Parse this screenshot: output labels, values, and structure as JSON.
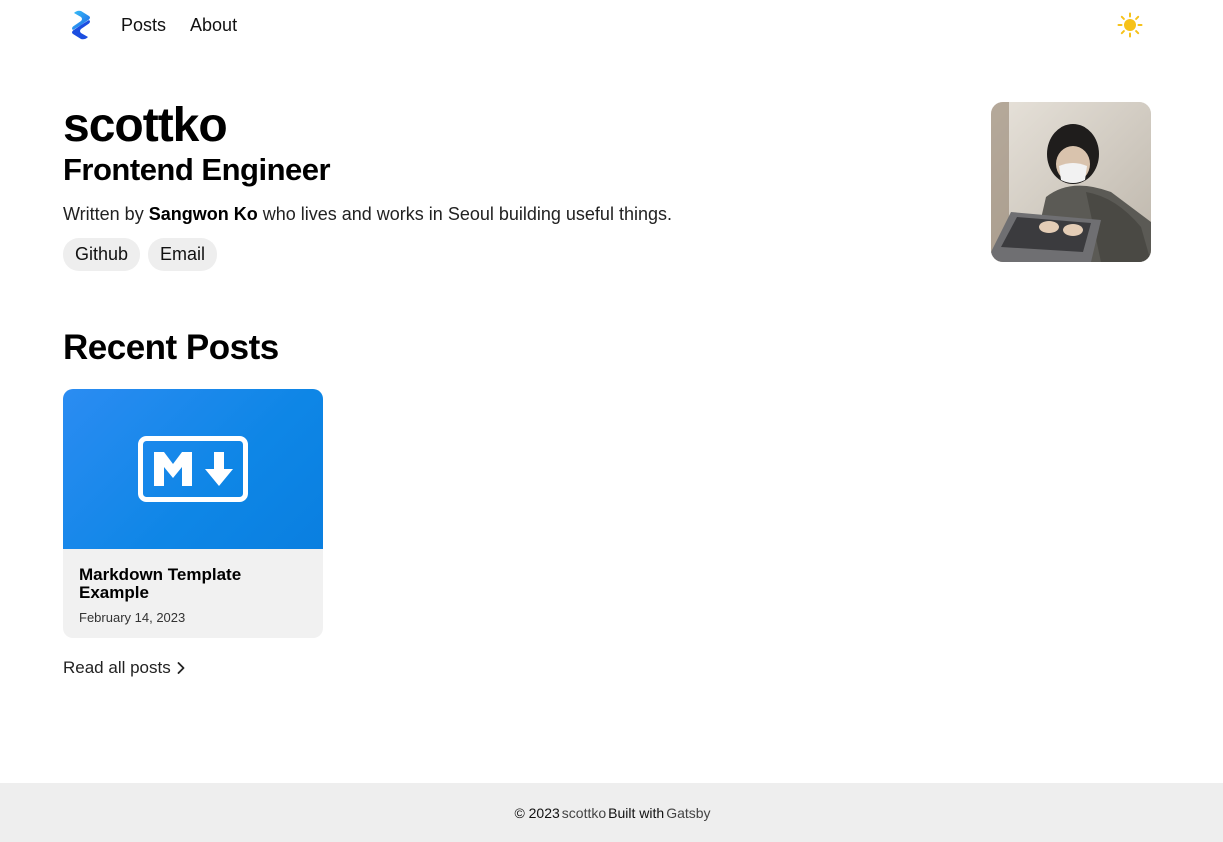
{
  "nav": {
    "logo_icon": "blog-logo-icon",
    "links": [
      {
        "label": "Posts"
      },
      {
        "label": "About"
      }
    ],
    "theme_icon": "sun-icon"
  },
  "hero": {
    "name": "scottko",
    "role": "Frontend Engineer",
    "bio_prefix": "Written by",
    "bio_author": "Sangwon Ko",
    "bio_suffix": "who lives and works in Seoul building useful things.",
    "links": [
      {
        "label": "Github"
      },
      {
        "label": "Email"
      }
    ],
    "avatar_icon": "profile-photo"
  },
  "recent": {
    "title": "Recent Posts",
    "posts": [
      {
        "title": "Markdown Template Example",
        "date": "February 14, 2023",
        "thumbnail_icon": "markdown-icon"
      }
    ],
    "read_all": "Read all posts"
  },
  "footer": {
    "copyright": "© 2023",
    "site_name": "scottko",
    "built_with": "Built with",
    "framework": "Gatsby"
  },
  "colors": {
    "thumb_blue": "#0e86e6",
    "sun": "#f6c21a",
    "logo_dark": "#1d4fd8",
    "logo_light": "#35b6f5"
  }
}
